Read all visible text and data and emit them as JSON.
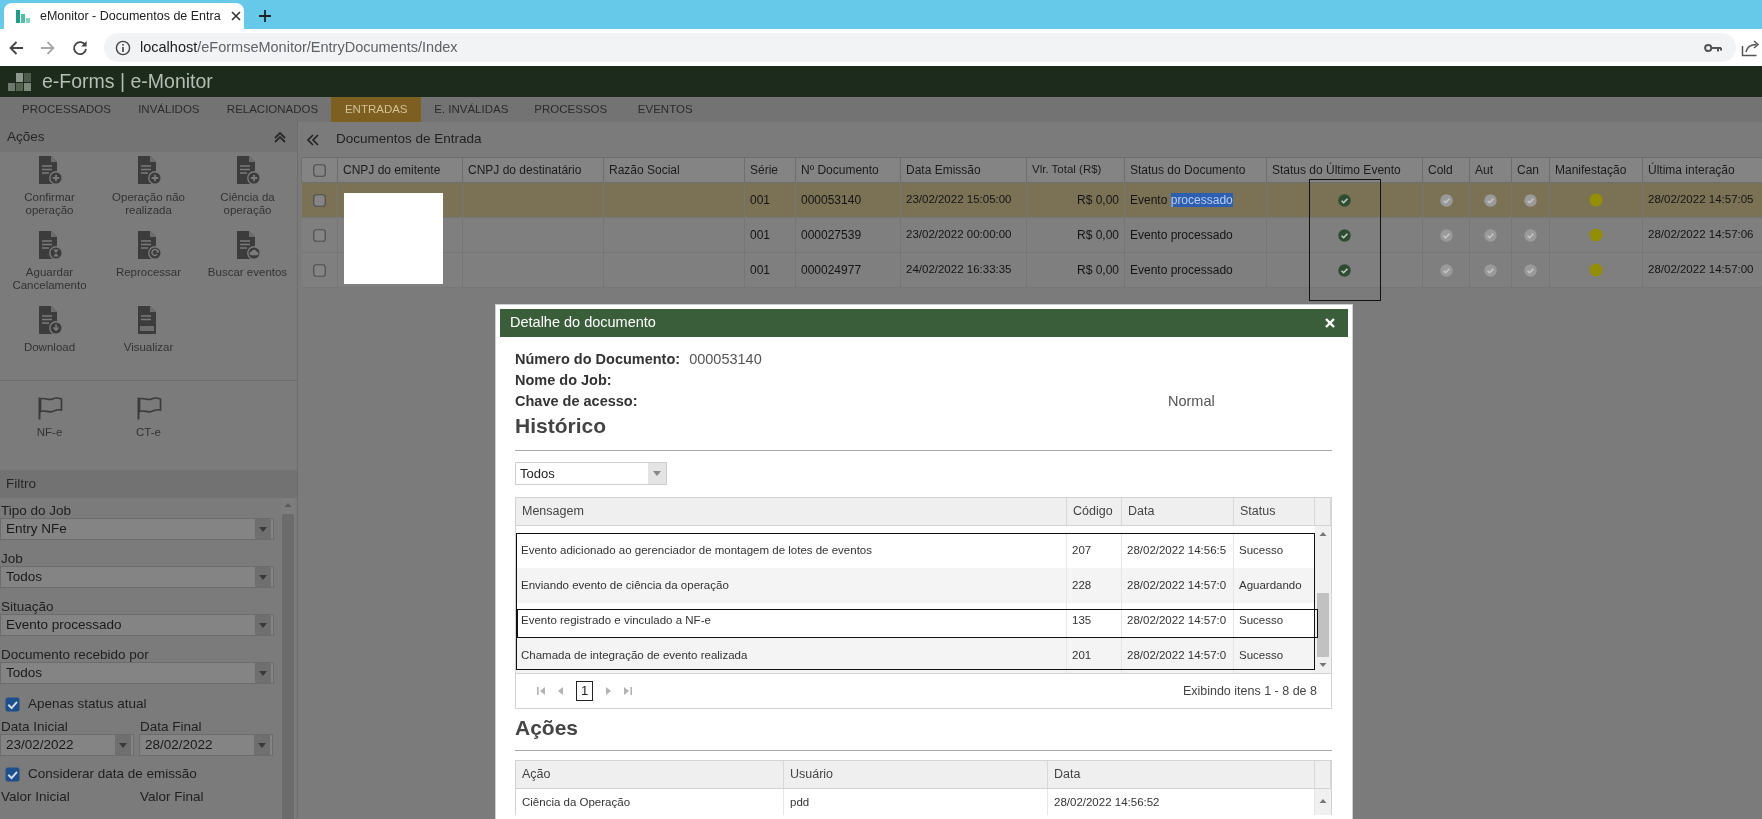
{
  "browser": {
    "tab_title": "eMonitor - Documentos de Entra",
    "url_host": "localhost",
    "url_path": "/eFormseMonitor/EntryDocuments/Index"
  },
  "app": {
    "title": "e-Forms | e-Monitor"
  },
  "nav": [
    {
      "label": "PROCESSADOS",
      "selected": false
    },
    {
      "label": "INVÁLIDOS",
      "selected": false
    },
    {
      "label": "RELACIONADOS",
      "selected": false
    },
    {
      "label": "ENTRADAS",
      "selected": true
    },
    {
      "label": "E. INVÁLIDAS",
      "selected": false
    },
    {
      "label": "PROCESSOS",
      "selected": false
    },
    {
      "label": "EVENTOS",
      "selected": false
    }
  ],
  "sidebar": {
    "actions_title": "Ações",
    "actions": [
      {
        "label": "Confirmar operação",
        "kind": "plus"
      },
      {
        "label": "Operação não realizada",
        "kind": "plus"
      },
      {
        "label": "Ciência da operação",
        "kind": "plus"
      },
      {
        "label": "Aguardar Cancelamento",
        "kind": "hourglass"
      },
      {
        "label": "Reprocessar",
        "kind": "refresh"
      },
      {
        "label": "Buscar eventos",
        "kind": "cloud"
      },
      {
        "label": "Download",
        "kind": "download"
      },
      {
        "label": "Visualizar",
        "kind": "pdf"
      }
    ],
    "document_types": [
      {
        "label": "NF-e"
      },
      {
        "label": "CT-e"
      }
    ],
    "filter_title": "Filtro",
    "filters": [
      {
        "kind": "select",
        "label": "Tipo do Job",
        "value": "Entry NFe"
      },
      {
        "kind": "select",
        "label": "Job",
        "value": "Todos"
      },
      {
        "kind": "select",
        "label": "Situação",
        "value": "Evento processado"
      },
      {
        "kind": "select",
        "label": "Documento recebido por",
        "value": "Todos"
      },
      {
        "kind": "checkbox",
        "label": "Apenas status atual",
        "checked": true
      },
      {
        "kind": "date_range",
        "fields": [
          {
            "label": "Data Inicial",
            "value": "23/02/2022"
          },
          {
            "label": "Data Final",
            "value": "28/02/2022"
          }
        ]
      },
      {
        "kind": "checkbox",
        "label": "Considerar data de emissão",
        "checked": true
      },
      {
        "kind": "label_pair",
        "labels": [
          "Valor Inicial",
          "Valor Final"
        ]
      }
    ]
  },
  "main": {
    "title": "Documentos de Entrada",
    "table": {
      "header_checked": false,
      "columns": [
        {
          "label": "CNPJ do emitente",
          "framed": false,
          "covered": true
        },
        {
          "label": "CNPJ do destinatário",
          "framed": false,
          "covered": false
        },
        {
          "label": "Razão Social",
          "framed": false,
          "covered": false
        },
        {
          "label": "Série",
          "framed": false,
          "covered": false
        },
        {
          "label": "Nº Documento",
          "framed": false,
          "covered": false
        },
        {
          "label": "Data Emissão",
          "framed": false,
          "covered": false
        },
        {
          "label": "Vlr. Total (R$)",
          "framed": false,
          "covered": false
        },
        {
          "label": "Status do Documento",
          "framed": false,
          "covered": false
        },
        {
          "label": "Status do Último Evento",
          "framed": true,
          "covered": false
        },
        {
          "label": "Cold",
          "framed": false,
          "covered": false
        },
        {
          "label": "Aut",
          "framed": false,
          "covered": false
        },
        {
          "label": "Can",
          "framed": false,
          "covered": false
        },
        {
          "label": "Manifestação",
          "framed": false,
          "covered": false
        },
        {
          "label": "Última interação",
          "framed": false,
          "covered": false
        }
      ],
      "rows": [
        {
          "selected": true,
          "checked": false,
          "series": "001",
          "number": "000053140",
          "issue_date": "23/02/2022 15:05:00",
          "total": "R$ 0,00",
          "status": "Evento",
          "status_selected_text": "processado",
          "last_event_ok": true,
          "cold": false,
          "aut": false,
          "can": false,
          "manifestation_dot": {
            "color": "#938f00"
          },
          "last_interaction": "28/02/2022 14:57:05"
        },
        {
          "selected": false,
          "checked": false,
          "series": "001",
          "number": "000027539",
          "issue_date": "23/02/2022 00:00:00",
          "total": "R$ 0,00",
          "status": "Evento processado",
          "last_event_ok": true,
          "cold": false,
          "aut": false,
          "can": false,
          "manifestation_dot": {
            "color": "#938f00"
          },
          "last_interaction": "28/02/2022 14:57:06"
        },
        {
          "selected": false,
          "checked": false,
          "series": "001",
          "number": "000024977",
          "issue_date": "24/02/2022 16:33:35",
          "total": "R$ 0,00",
          "status": "Evento processado",
          "last_event_ok": true,
          "cold": false,
          "aut": false,
          "can": false,
          "manifestation_dot": {
            "color": "#938f00"
          },
          "last_interaction": "28/02/2022 14:57:00"
        }
      ]
    }
  },
  "modal": {
    "title": "Detalhe do documento",
    "fields": [
      {
        "label": "Número do Documento:",
        "value": "000053140"
      },
      {
        "label": "Nome do Job:"
      },
      {
        "label": "Chave de acesso:",
        "note": "Normal"
      }
    ],
    "history": {
      "title": "Histórico",
      "filter": "Todos",
      "columns": [
        "Mensagem",
        "Código",
        "Data",
        "Status"
      ],
      "rows": [
        {
          "message": "Evento adicionado ao gerenciador de montagem de lotes de eventos",
          "code": "207",
          "date": "28/02/2022 14:56:5",
          "status": "Sucesso",
          "framed": true,
          "outlined": false
        },
        {
          "message": "Enviando evento de ciência da operação",
          "code": "228",
          "date": "28/02/2022 14:57:0",
          "status": "Aguardando",
          "framed": true,
          "outlined": false
        },
        {
          "message": "Evento registrado e vinculado a NF-e",
          "code": "135",
          "date": "28/02/2022 14:57:0",
          "status": "Sucesso",
          "framed": true,
          "outlined": true
        },
        {
          "message": "Chamada de integração de evento realizada",
          "code": "201",
          "date": "28/02/2022 14:57:0",
          "status": "Sucesso",
          "framed": true,
          "outlined": false
        }
      ],
      "pager": {
        "nav_disabled": true,
        "pages": [
          {
            "label": "1",
            "selected": true
          }
        ],
        "summary": "Exibindo itens 1 - 8 de 8"
      }
    },
    "actions": {
      "title": "Ações",
      "columns": [
        "Ação",
        "Usuário",
        "Data"
      ],
      "rows": [
        {
          "action": "Ciência da Operação",
          "user": "pdd",
          "date": "28/02/2022 14:56:52"
        }
      ]
    }
  }
}
